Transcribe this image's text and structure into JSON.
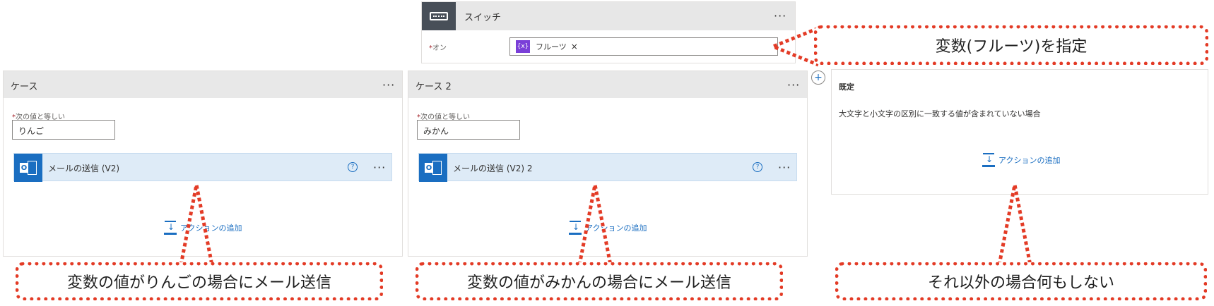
{
  "switch": {
    "title": "スイッチ",
    "on_label": "オン",
    "required_mark": "*",
    "token": "フルーツ",
    "token_icon": "{x}",
    "token_remove": "×",
    "ellipsis": "···"
  },
  "cases": [
    {
      "title": "ケース",
      "field_label": "次の値と等しい",
      "value": "りんご",
      "action_name": "メールの送信 (V2)",
      "add_action": "アクションの追加"
    },
    {
      "title": "ケース 2",
      "field_label": "次の値と等しい",
      "value": "みかん",
      "action_name": "メールの送信 (V2) 2",
      "add_action": "アクションの追加"
    }
  ],
  "default": {
    "title": "既定",
    "description": "大文字と小文字の区別に一致する値が含まれていない場合",
    "add_action": "アクションの追加"
  },
  "annotations": {
    "switch_note": "変数(フルーツ)を指定",
    "case1_note": "変数の値がりんごの場合にメール送信",
    "case2_note": "変数の値がみかんの場合にメール送信",
    "default_note": "それ以外の場合何もしない"
  },
  "help_glyph": "?",
  "colors": {
    "annotation_red": "#e33b26",
    "link_blue": "#1a6ec1",
    "token_purple": "#7a3fd8",
    "header_gray": "#e8e8e8"
  }
}
